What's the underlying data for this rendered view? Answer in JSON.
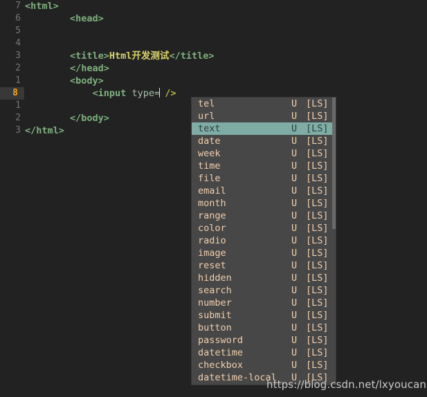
{
  "editor": {
    "background_color": "#222222",
    "lines": [
      {
        "gutter": "7",
        "indent": 0,
        "current": false,
        "segments": [
          {
            "t": "tag",
            "v": "<html>"
          }
        ]
      },
      {
        "gutter": "6",
        "indent": 0,
        "current": false,
        "segments": [
          {
            "t": "tag",
            "v": "        <head>"
          }
        ]
      },
      {
        "gutter": "5",
        "indent": 0,
        "current": false,
        "segments": []
      },
      {
        "gutter": "4",
        "indent": 0,
        "current": false,
        "segments": []
      },
      {
        "gutter": "3",
        "indent": 0,
        "current": false,
        "segments": [
          {
            "t": "tag",
            "v": "        <title>"
          },
          {
            "t": "title-txt",
            "v": "Html开发测试"
          },
          {
            "t": "tag",
            "v": "</title>"
          }
        ]
      },
      {
        "gutter": "2",
        "indent": 0,
        "current": false,
        "segments": [
          {
            "t": "tag",
            "v": "        </head>"
          }
        ]
      },
      {
        "gutter": "1",
        "indent": 0,
        "current": false,
        "segments": [
          {
            "t": "tag",
            "v": "        <body>"
          }
        ]
      },
      {
        "gutter": "8",
        "indent": 0,
        "current": true,
        "segments": [
          {
            "t": "tag",
            "v": "            <input "
          },
          {
            "t": "attr",
            "v": "type="
          },
          {
            "t": "caret",
            "v": ""
          },
          {
            "t": "selfclose",
            "v": " />"
          }
        ]
      },
      {
        "gutter": "1",
        "indent": 0,
        "current": false,
        "segments": []
      },
      {
        "gutter": "2",
        "indent": 0,
        "current": false,
        "segments": [
          {
            "t": "tag",
            "v": "        </body>"
          }
        ]
      },
      {
        "gutter": "3",
        "indent": 0,
        "current": false,
        "segments": [
          {
            "t": "tag",
            "v": "</html>"
          }
        ]
      }
    ]
  },
  "autocomplete": {
    "selected_index": 2,
    "selected_value": "text",
    "selected_bg_color": "#7fada6",
    "popup_bg_color": "#474747",
    "item_text_color": "#f2cfae",
    "column_kind": "U",
    "column_source": "[LS]",
    "items": [
      {
        "label": "tel",
        "kind": "U",
        "source": "[LS]"
      },
      {
        "label": "url",
        "kind": "U",
        "source": "[LS]"
      },
      {
        "label": "text",
        "kind": "U",
        "source": "[LS]"
      },
      {
        "label": "date",
        "kind": "U",
        "source": "[LS]"
      },
      {
        "label": "week",
        "kind": "U",
        "source": "[LS]"
      },
      {
        "label": "time",
        "kind": "U",
        "source": "[LS]"
      },
      {
        "label": "file",
        "kind": "U",
        "source": "[LS]"
      },
      {
        "label": "email",
        "kind": "U",
        "source": "[LS]"
      },
      {
        "label": "month",
        "kind": "U",
        "source": "[LS]"
      },
      {
        "label": "range",
        "kind": "U",
        "source": "[LS]"
      },
      {
        "label": "color",
        "kind": "U",
        "source": "[LS]"
      },
      {
        "label": "radio",
        "kind": "U",
        "source": "[LS]"
      },
      {
        "label": "image",
        "kind": "U",
        "source": "[LS]"
      },
      {
        "label": "reset",
        "kind": "U",
        "source": "[LS]"
      },
      {
        "label": "hidden",
        "kind": "U",
        "source": "[LS]"
      },
      {
        "label": "search",
        "kind": "U",
        "source": "[LS]"
      },
      {
        "label": "number",
        "kind": "U",
        "source": "[LS]"
      },
      {
        "label": "submit",
        "kind": "U",
        "source": "[LS]"
      },
      {
        "label": "button",
        "kind": "U",
        "source": "[LS]"
      },
      {
        "label": "password",
        "kind": "U",
        "source": "[LS]"
      },
      {
        "label": "datetime",
        "kind": "U",
        "source": "[LS]"
      },
      {
        "label": "checkbox",
        "kind": "U",
        "source": "[LS]"
      },
      {
        "label": "datetime-local",
        "kind": "U",
        "source": "[LS]"
      }
    ]
  },
  "watermark": {
    "text": "https://blog.csdn.net/lxyoucan"
  }
}
